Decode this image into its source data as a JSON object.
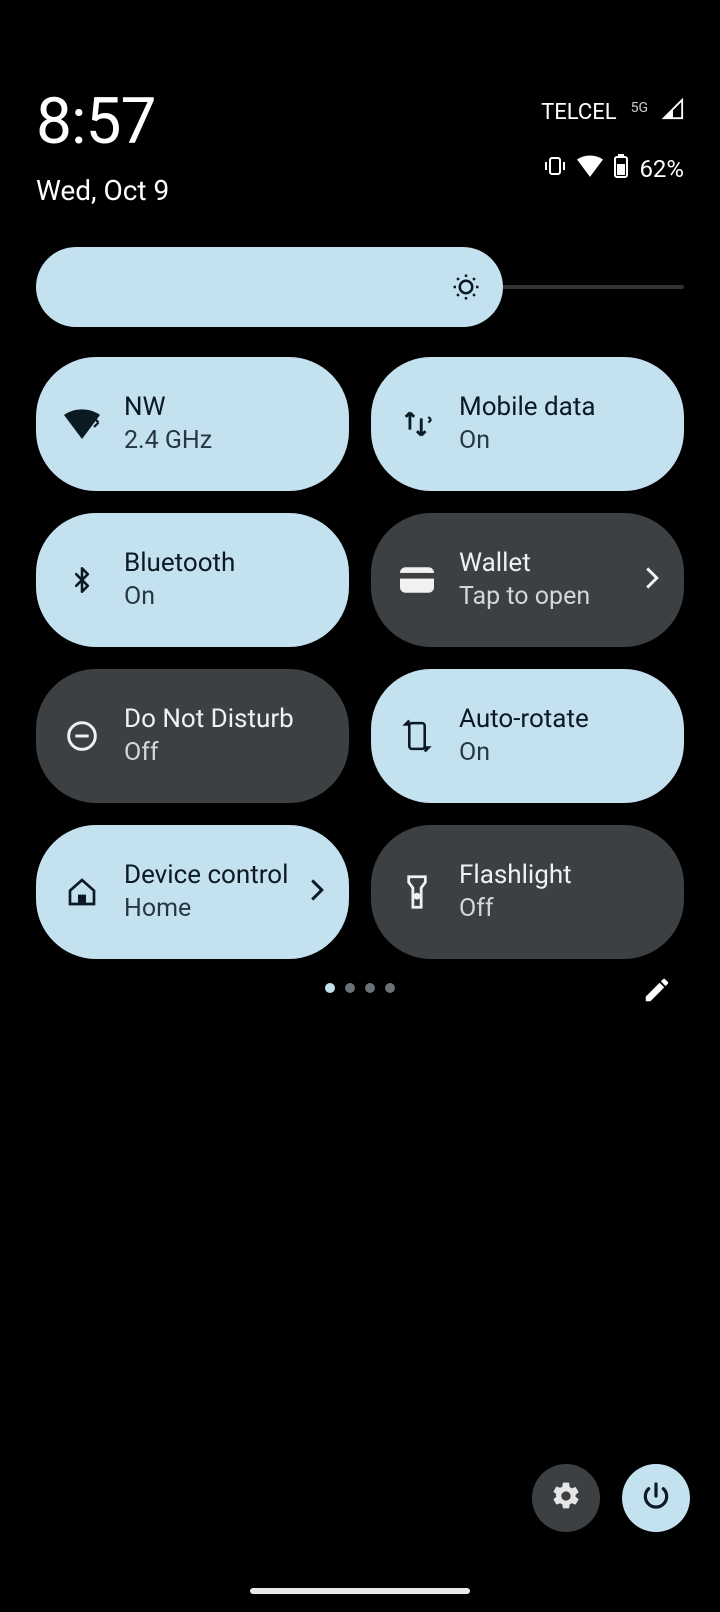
{
  "status": {
    "time": "8:57",
    "date": "Wed, Oct 9",
    "carrier": "TELCEL",
    "network_type": "5G",
    "battery_text": "62%"
  },
  "brightness": {
    "percent": 72
  },
  "tiles": [
    {
      "id": "wifi",
      "title": "NW",
      "sub": "2.4 GHz",
      "state": "on",
      "chevron": false
    },
    {
      "id": "mobile-data",
      "title": "Mobile data",
      "sub": "On",
      "state": "on",
      "chevron": false
    },
    {
      "id": "bluetooth",
      "title": "Bluetooth",
      "sub": "On",
      "state": "on",
      "chevron": false
    },
    {
      "id": "wallet",
      "title": "Wallet",
      "sub": "Tap to open",
      "state": "off",
      "chevron": true
    },
    {
      "id": "dnd",
      "title": "Do Not Disturb",
      "sub": "Off",
      "state": "off",
      "chevron": false
    },
    {
      "id": "autorotate",
      "title": "Auto-rotate",
      "sub": "On",
      "state": "on",
      "chevron": false
    },
    {
      "id": "device-ctrl",
      "title": "Device control",
      "sub": "Home",
      "state": "on",
      "chevron": true
    },
    {
      "id": "flashlight",
      "title": "Flashlight",
      "sub": "Off",
      "state": "off",
      "chevron": false
    }
  ],
  "pagination": {
    "current": 0,
    "total": 4
  }
}
